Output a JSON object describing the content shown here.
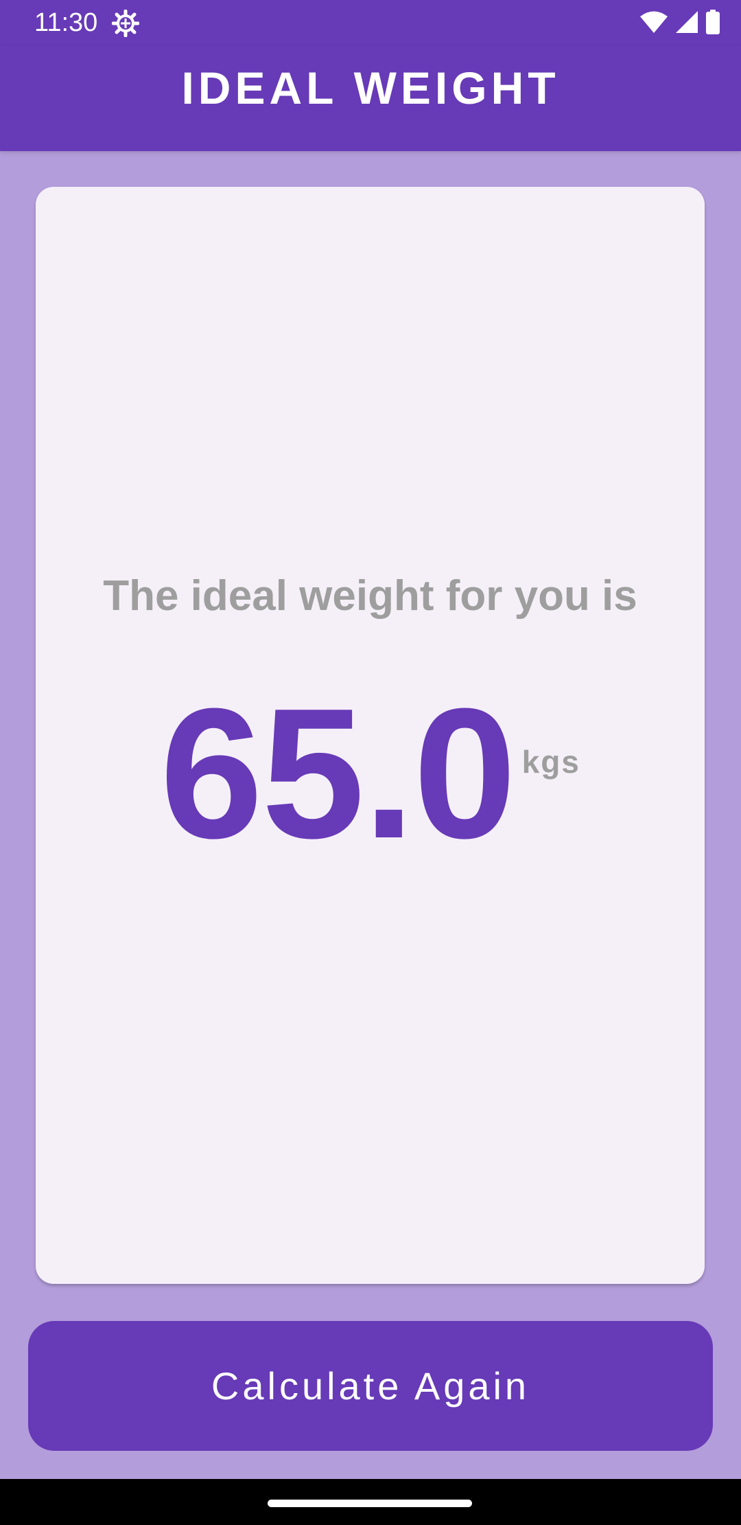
{
  "status_bar": {
    "time": "11:30",
    "icons": [
      "settings-gear-icon",
      "wifi-icon",
      "signal-icon",
      "battery-icon"
    ]
  },
  "app_bar": {
    "title": "IDEAL WEIGHT"
  },
  "result": {
    "label": "The ideal weight for you is",
    "value": "65.0",
    "unit": "kgs"
  },
  "actions": {
    "calculate_again_label": "Calculate Again"
  },
  "colors": {
    "primary": "#673AB7",
    "background": "#B39DDB",
    "card": "#F5F0F8",
    "muted_text": "#9E9E9E"
  }
}
